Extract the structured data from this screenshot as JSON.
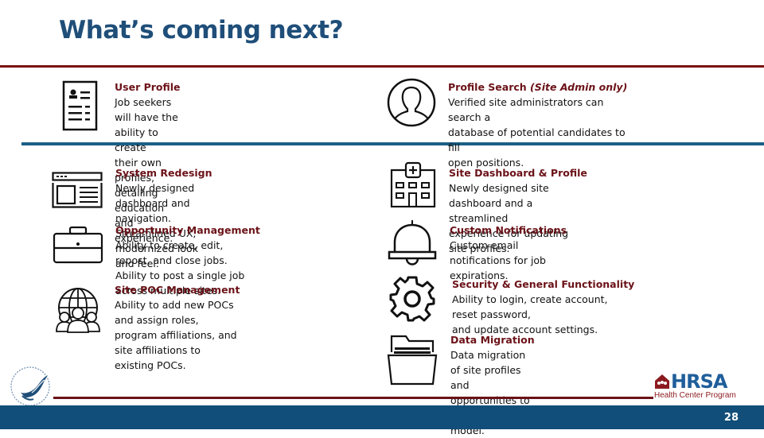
{
  "header": {
    "title": "What’s coming next?"
  },
  "items": [
    {
      "title": "User Profile",
      "title_note": "",
      "description": "Job seekers will have the ability to create\ntheir own profiles, detailing education\nand experience.",
      "icon": "user-profile-document-icon"
    },
    {
      "title": "Profile Search ",
      "title_note": "(Site Admin only)",
      "description": "Verified site administrators can search a\ndatabase of potential candidates to fill\nopen positions.",
      "icon": "user-avatar-circle-icon"
    },
    {
      "title": "System Redesign",
      "title_note": "",
      "description": "Newly designed dashboard and navigation.\nStreamlined UX, modernized look and feel.",
      "icon": "browser-window-icon"
    },
    {
      "title": "Site Dashboard & Profile",
      "title_note": "",
      "description": "Newly designed site dashboard and a streamlined\nexperience for updating site profiles.",
      "icon": "hospital-building-icon"
    },
    {
      "title": "Opportunity Management",
      "title_note": "",
      "description": "Ability to create, edit, repost, and close jobs.\nAbility to post a single job across multiple sites.",
      "icon": "briefcase-icon"
    },
    {
      "title": "Custom Notifications",
      "title_note": "",
      "description": "Custom email notifications for job expirations.",
      "icon": "bell-icon"
    },
    {
      "title": "Site POC Management",
      "title_note": "",
      "description": "Ability to add new POCs and assign roles,\nprogram affiliations, and site affiliations to\nexisting POCs.",
      "icon": "globe-people-icon"
    },
    {
      "title": "Security & General Functionality",
      "title_note": "",
      "description": "Ability to login, create account, reset password,\nand update account settings.",
      "icon": "gear-icon"
    },
    {
      "title": "Data Migration",
      "title_note": "",
      "description": "Data migration of site profiles and\nopportunities to the new data model.",
      "icon": "folder-icon"
    }
  ],
  "footer": {
    "page_number": "28",
    "logo_text": "HRSA",
    "logo_subtext": "Health Center Program"
  },
  "colors": {
    "title_blue": "#1f4e79",
    "accent_maroon": "#6b1218",
    "footer_blue": "#114e79",
    "divider_blue": "#1b5f86"
  }
}
